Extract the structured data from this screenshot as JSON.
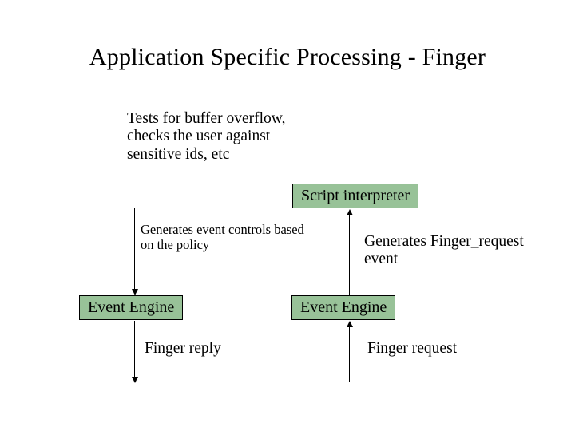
{
  "title": "Application Specific Processing - Finger",
  "texts": {
    "tests": "Tests for buffer overflow,\nchecks the user against\nsensitive ids, etc",
    "gen_policy": "Generates event controls based\non the policy",
    "gen_fr": "Generates Finger_request\nevent",
    "finger_reply": "Finger reply",
    "finger_request": "Finger request"
  },
  "boxes": {
    "script_interpreter": "Script interpreter",
    "event_engine_left": "Event Engine",
    "event_engine_right": "Event Engine"
  },
  "colors": {
    "box_fill": "#98c298"
  }
}
